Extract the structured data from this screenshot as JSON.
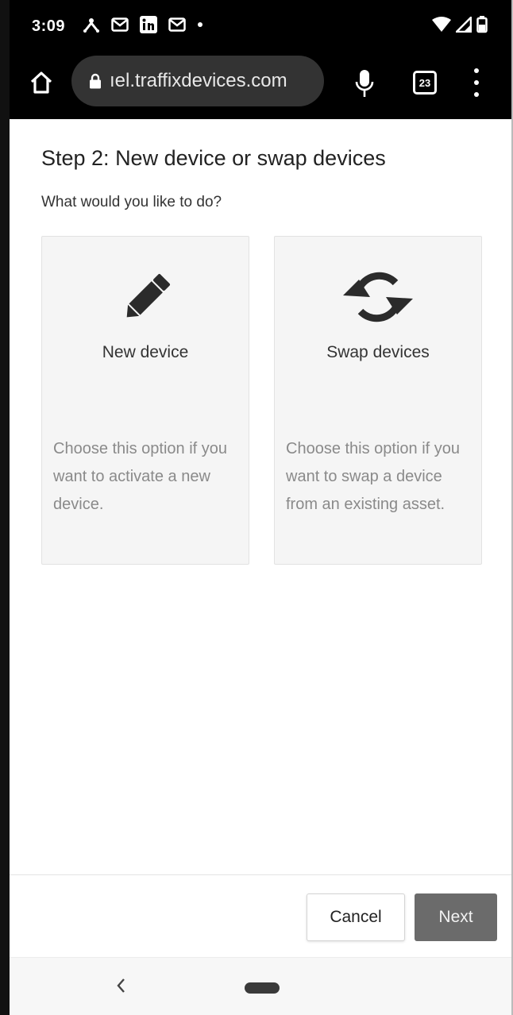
{
  "status_bar": {
    "time": "3:09",
    "left_icons": [
      "network-icon",
      "gmail-icon",
      "linkedin-icon",
      "gmail-icon",
      "dot-icon"
    ],
    "right_icons": [
      "wifi-icon",
      "signal-icon",
      "battery-icon"
    ]
  },
  "browser": {
    "url": "ıel.traffixdevices.com",
    "tab_count": "23"
  },
  "page": {
    "title": "Step 2: New device or swap devices",
    "question": "What would you like to do?"
  },
  "options": [
    {
      "icon": "pencil-icon",
      "title": "New device",
      "description": "Choose this option if you want to activate a new device."
    },
    {
      "icon": "swap-arrows-icon",
      "title": "Swap devices",
      "description": "Choose this option if you want to swap a device from an existing asset."
    }
  ],
  "footer": {
    "cancel_label": "Cancel",
    "next_label": "Next"
  },
  "colors": {
    "chrome_bar": "#000000",
    "omnibox": "#333333",
    "card_bg": "#f5f5f5",
    "next_button": "#6b6b6b",
    "muted_text": "#8a8a8a"
  }
}
